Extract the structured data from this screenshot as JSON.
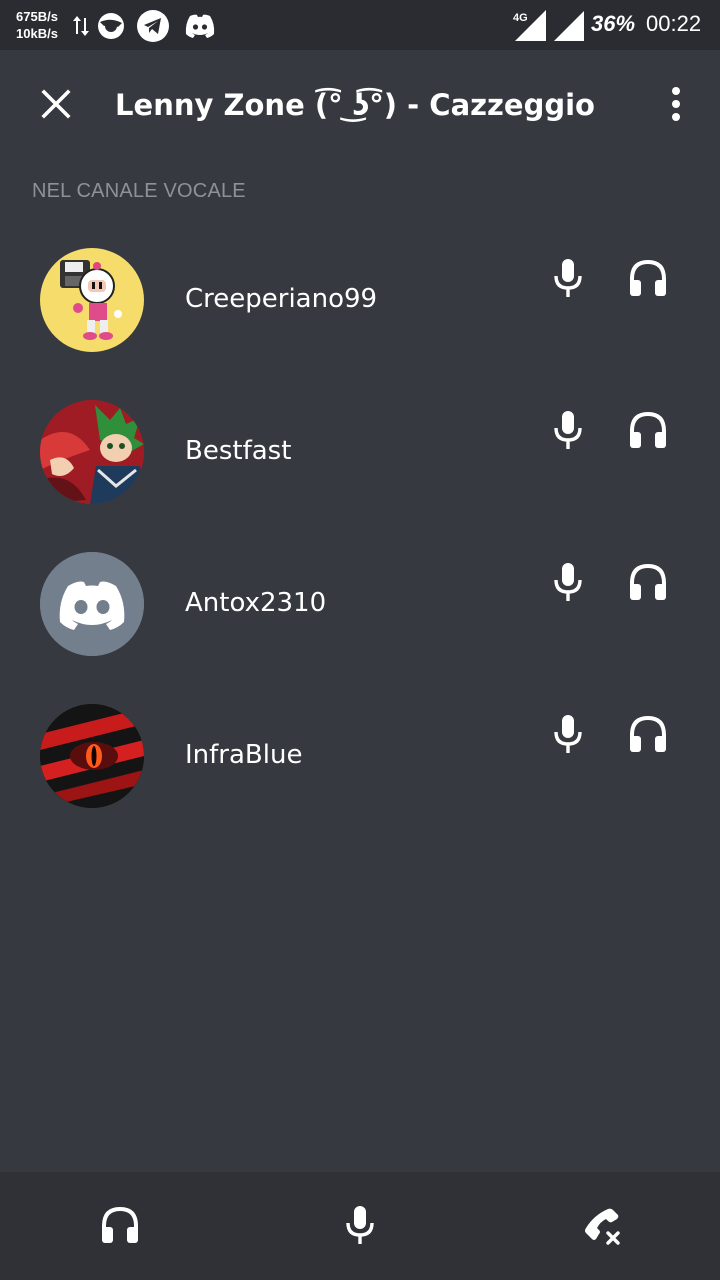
{
  "status_bar": {
    "net_down": "675B/s",
    "net_up": "10kB/s",
    "network_type": "4G",
    "battery": "36%",
    "time": "00:22",
    "notification_icons": [
      "transfer-arrows-icon",
      "browser-icon",
      "telegram-icon",
      "discord-icon"
    ]
  },
  "header": {
    "title": "Lenny Zone (͡° ͜ʖ͡°) - Cazzeggio",
    "close_icon": "close-icon",
    "menu_icon": "more-vertical-icon"
  },
  "section_label": "NEL CANALE VOCALE",
  "members": [
    {
      "name": "Creeperiano99",
      "avatar": "bomberman-avatar",
      "avatar_bg": "#f5dc6b"
    },
    {
      "name": "Bestfast",
      "avatar": "anime-hero-avatar",
      "avatar_bg": "#b5202a"
    },
    {
      "name": "Antox2310",
      "avatar": "discord-default-avatar",
      "avatar_bg": "#747f8d"
    },
    {
      "name": "InfraBlue",
      "avatar": "red-eye-avatar",
      "avatar_bg": "#1a1a1a"
    }
  ],
  "bottom_bar": {
    "buttons": [
      "headphones-icon",
      "microphone-icon",
      "disconnect-call-icon"
    ]
  },
  "colors": {
    "background": "#36393f",
    "status_bar": "#2a2c31",
    "bottom_bar": "#2f3136",
    "muted_text": "#8e9297"
  }
}
